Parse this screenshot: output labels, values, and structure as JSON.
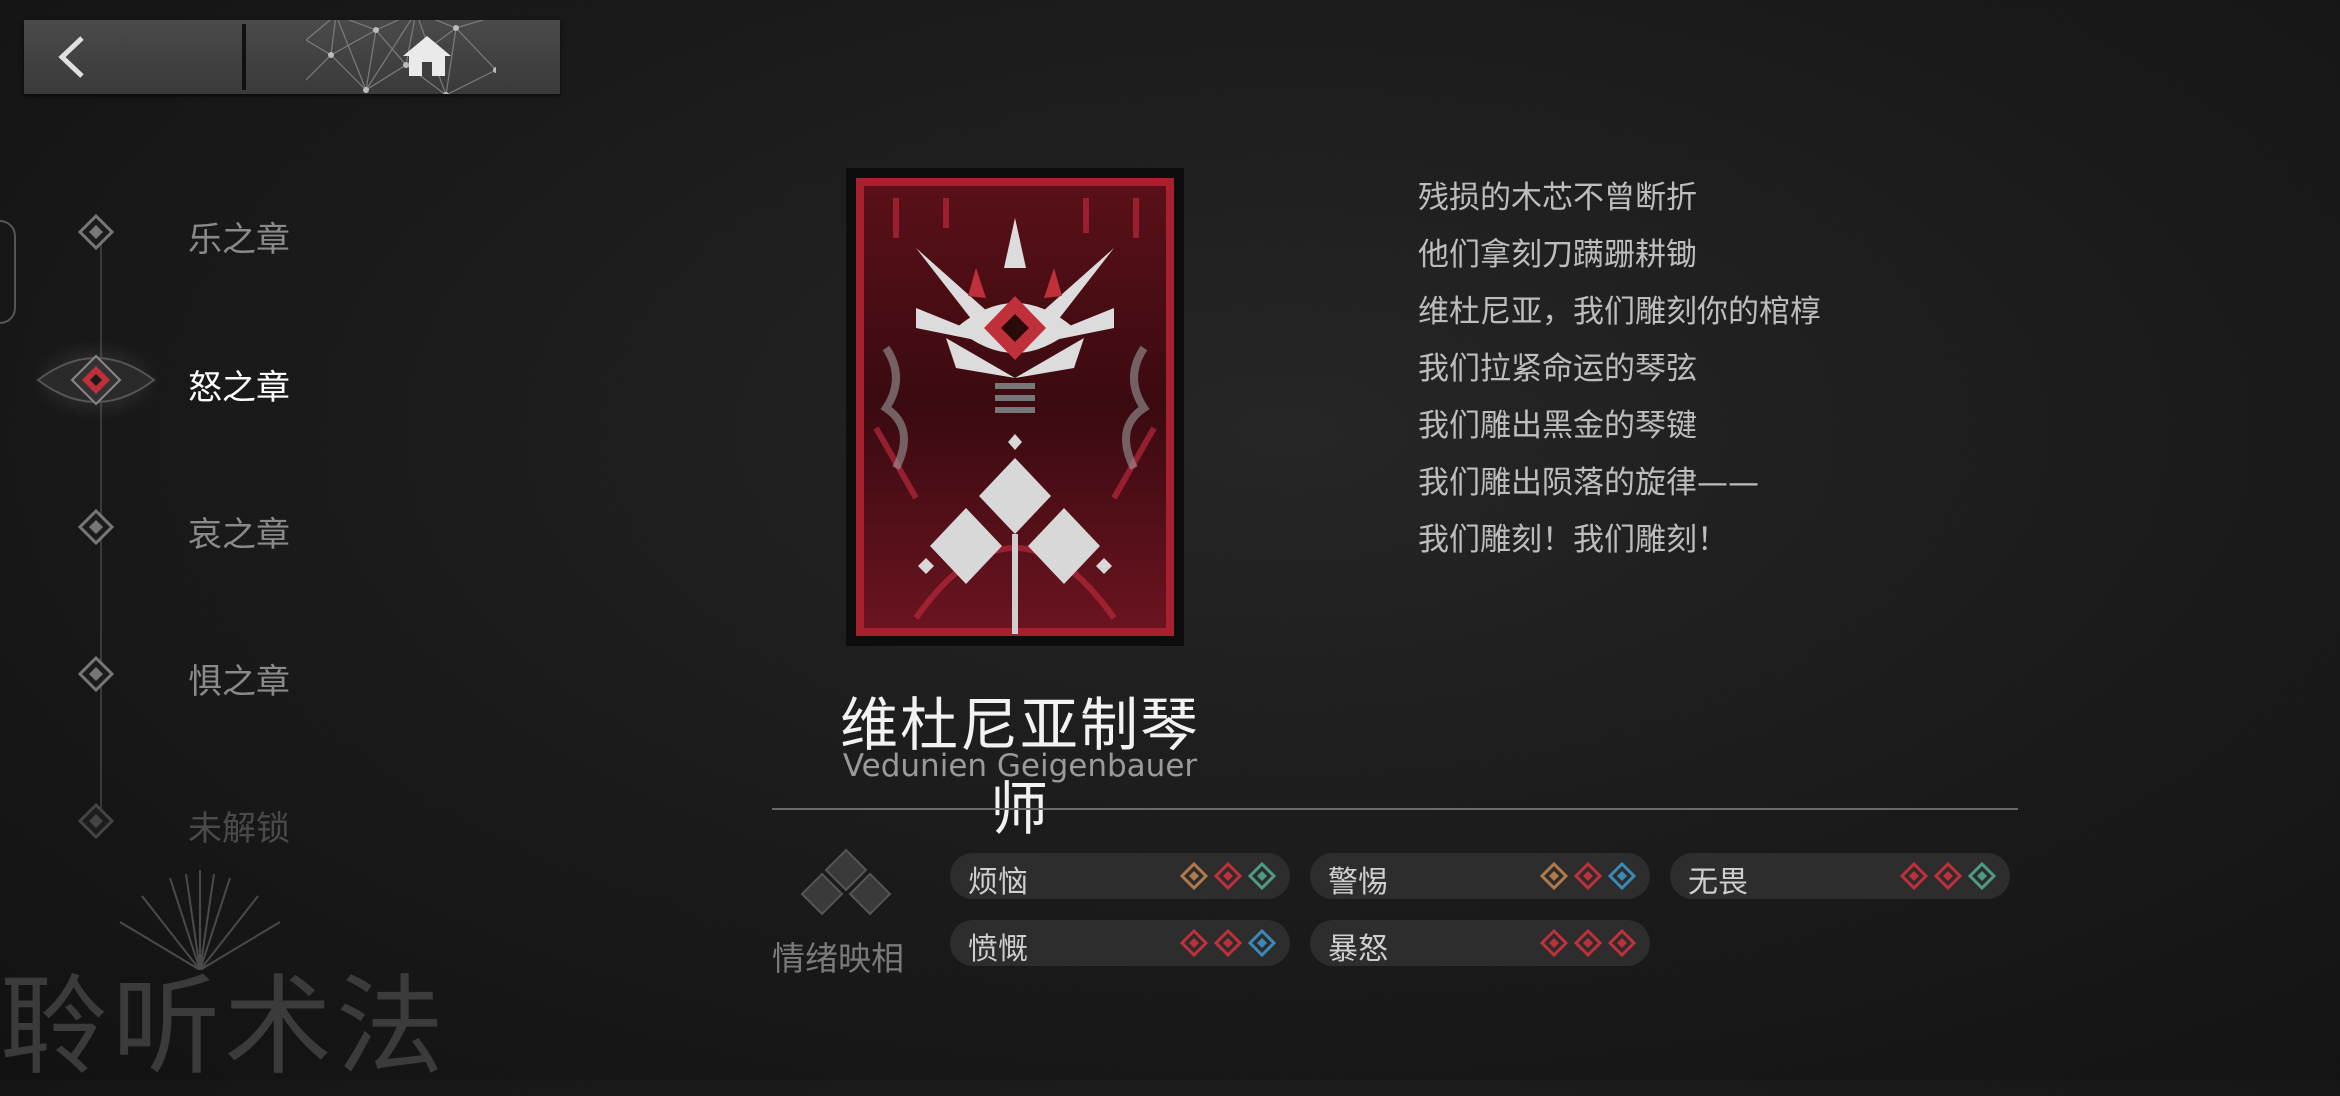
{
  "chapters": [
    {
      "label": "乐之章",
      "state": "normal"
    },
    {
      "label": "怒之章",
      "state": "active"
    },
    {
      "label": "哀之章",
      "state": "normal"
    },
    {
      "label": "惧之章",
      "state": "normal"
    },
    {
      "label": "未解锁",
      "state": "locked"
    }
  ],
  "character": {
    "name_cn": "维杜尼亚制琴师",
    "name_en": "Vedunien Geigenbauer"
  },
  "poem": [
    "残损的木芯不曾断折",
    "他们拿刻刀蹒跚耕锄",
    "维杜尼亚，我们雕刻你的棺椁",
    "我们拉紧命运的琴弦",
    "我们雕出黑金的琴键",
    "我们雕出陨落的旋律——",
    "我们雕刻！我们雕刻！"
  ],
  "emotions": {
    "title": "情绪映相",
    "items": [
      {
        "name": "烦恼",
        "gems": [
          "#b07a4a",
          "#c0303a",
          "#4e9a86"
        ]
      },
      {
        "name": "警惕",
        "gems": [
          "#b07a4a",
          "#c0303a",
          "#3a8ab8"
        ]
      },
      {
        "name": "无畏",
        "gems": [
          "#c0303a",
          "#c0303a",
          "#4e9a86"
        ]
      },
      {
        "name": "愤慨",
        "gems": [
          "#c0303a",
          "#c0303a",
          "#3a8ab8"
        ]
      },
      {
        "name": "暴怒",
        "gems": [
          "#c0303a",
          "#c0303a",
          "#c0303a"
        ]
      }
    ]
  },
  "watermark": "聆听术法",
  "colors": {
    "accent_red": "#c0303a",
    "background": "#1c1c1c"
  }
}
